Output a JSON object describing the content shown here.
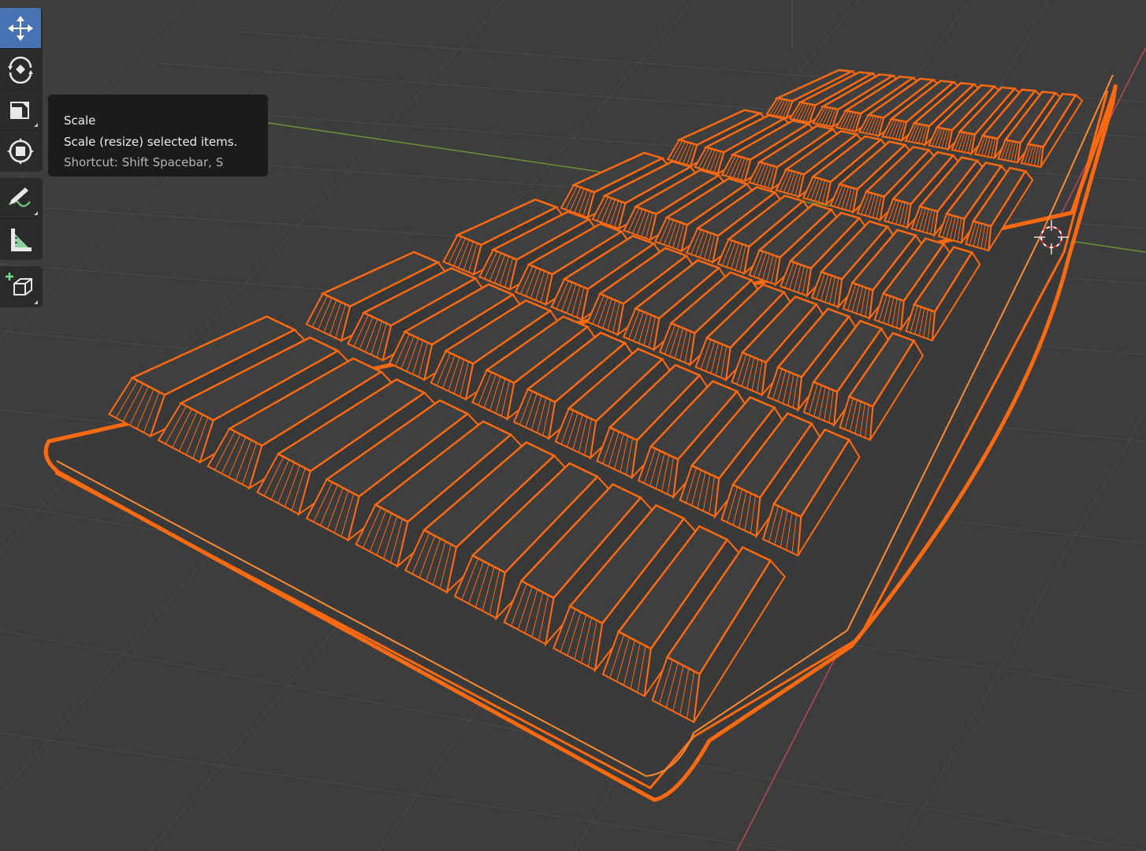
{
  "app": "3D viewport",
  "toolbar": {
    "group1": [
      {
        "name": "move-tool",
        "icon": "move-icon",
        "active": true
      },
      {
        "name": "rotate-tool",
        "icon": "rotate-icon",
        "active": false
      },
      {
        "name": "scale-tool",
        "icon": "scale-icon",
        "active": false
      },
      {
        "name": "transform-tool",
        "icon": "transform-icon",
        "active": false
      }
    ],
    "group2": [
      {
        "name": "annotate-tool",
        "icon": "annotate-pencil-icon"
      },
      {
        "name": "measure-tool",
        "icon": "measure-ruler-icon"
      }
    ],
    "group3": [
      {
        "name": "add-cube-tool",
        "icon": "add-cube-icon"
      }
    ]
  },
  "tooltip": {
    "title": "Scale",
    "description": "Scale (resize) selected items.",
    "shortcut": "Shortcut: Shift Spacebar, S"
  },
  "colors": {
    "background": "#3d3d3d",
    "grid": "#4a4a4a",
    "x_axis": "#c04a5c",
    "y_axis": "#7a9a3a",
    "selection": "#ff6a10",
    "active_tool": "#4772b3",
    "toolbar_bg": "#2b2b2b",
    "tooltip_bg": "#1b1b1b"
  },
  "scene": {
    "object": "keyboard-model",
    "mode": "wireframe-selected"
  }
}
